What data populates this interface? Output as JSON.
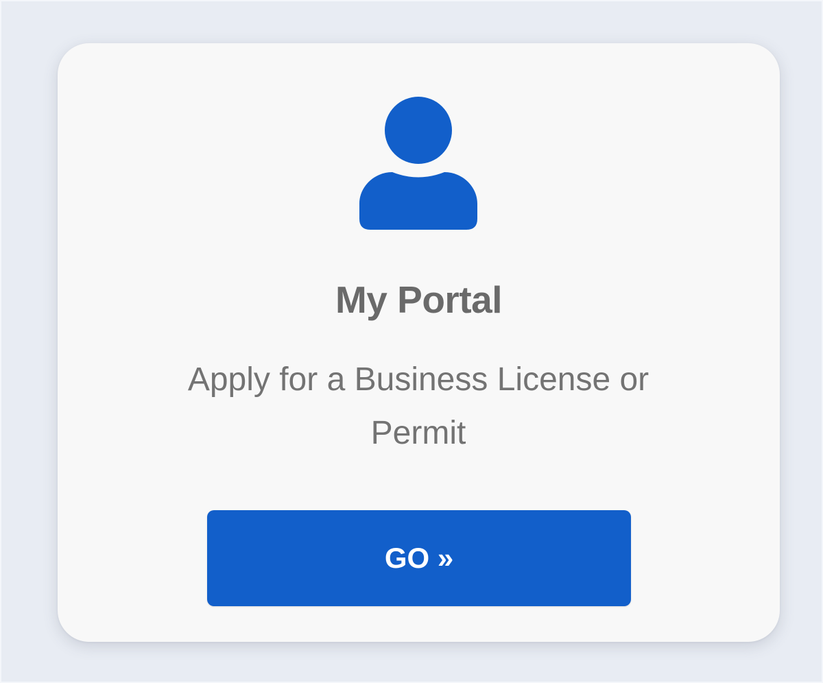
{
  "card": {
    "icon": "user-icon",
    "title": "My Portal",
    "description": "Apply for a Business License or Permit",
    "button_label": "GO »"
  },
  "colors": {
    "background": "#e8ecf3",
    "card": "#f8f8f8",
    "accent": "#125fca",
    "title_text": "#6a6a6a",
    "body_text": "#737373",
    "button_text": "#ffffff"
  }
}
